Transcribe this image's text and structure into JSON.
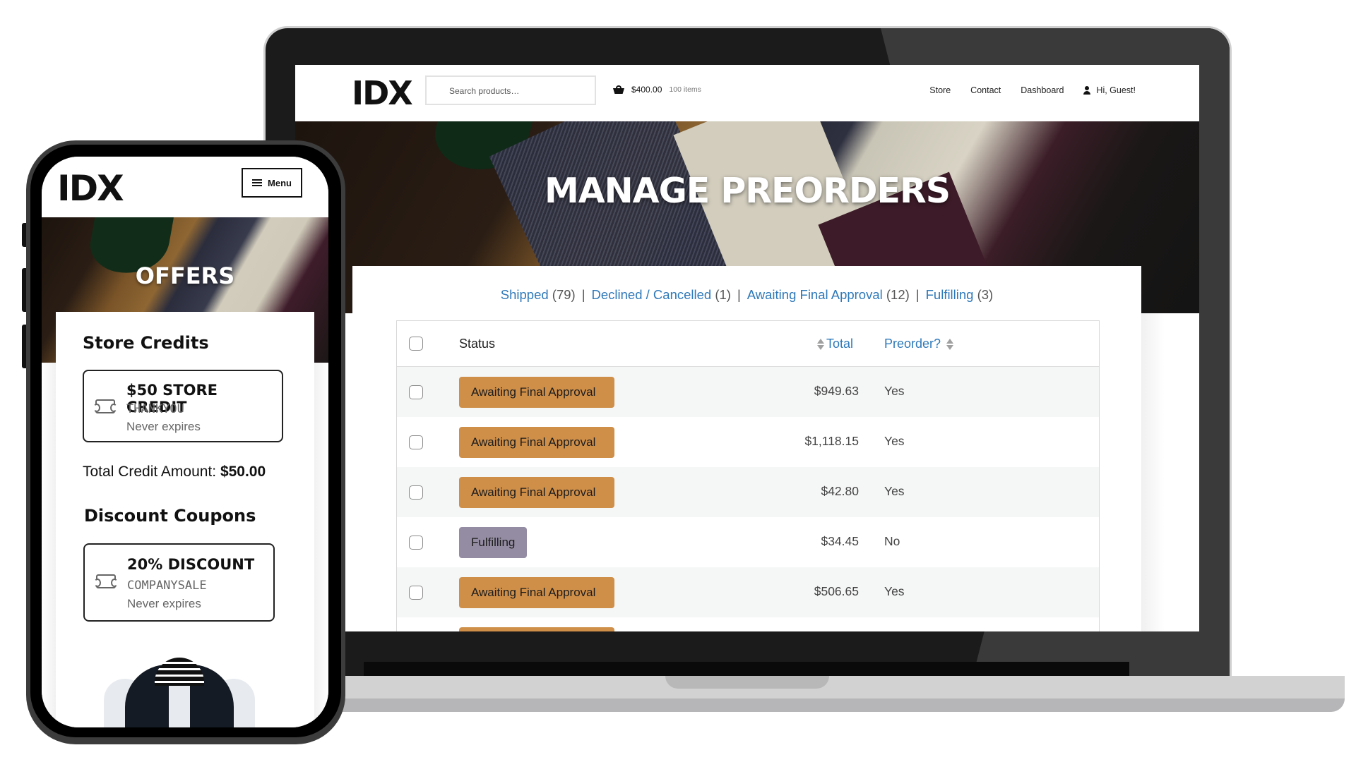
{
  "desktop": {
    "header": {
      "logo": "IDX",
      "search_placeholder": "Search products…",
      "cart_amount": "$400.00",
      "cart_items": "100 items",
      "nav": [
        "Store",
        "Contact",
        "Dashboard"
      ],
      "user_greeting": "Hi, Guest!"
    },
    "hero_title": "MANAGE PREORDERS",
    "filters": [
      {
        "label": "Shipped",
        "count": "(79)"
      },
      {
        "label": "Declined / Cancelled",
        "count": "(1)"
      },
      {
        "label": "Awaiting Final Approval",
        "count": "(12)"
      },
      {
        "label": "Fulfilling",
        "count": "(3)"
      }
    ],
    "table": {
      "columns": {
        "status": "Status",
        "total": "Total",
        "preorder": "Preorder?"
      },
      "rows": [
        {
          "status": "Awaiting Final Approval",
          "total": "$949.63",
          "preorder": "Yes"
        },
        {
          "status": "Awaiting Final Approval",
          "total": "$1,118.15",
          "preorder": "Yes"
        },
        {
          "status": "Awaiting Final Approval",
          "total": "$42.80",
          "preorder": "Yes"
        },
        {
          "status": "Fulfilling",
          "total": "$34.45",
          "preorder": "No"
        },
        {
          "status": "Awaiting Final Approval",
          "total": "$506.65",
          "preorder": "Yes"
        },
        {
          "status": "",
          "total": "",
          "preorder": ""
        }
      ]
    },
    "colors": {
      "link": "#2f79b9",
      "awaiting_badge": "#cf8f49",
      "fulfilling_badge": "#948ca2"
    }
  },
  "mobile": {
    "logo": "IDX",
    "menu_label": "Menu",
    "hero_title": "OFFERS",
    "store_credits_heading": "Store Credits",
    "store_credit": {
      "title": "$50 STORE CREDIT",
      "code": "THANKYOU",
      "expiry": "Never expires"
    },
    "total_credit_label": "Total Credit Amount:",
    "total_credit_value": "$50.00",
    "discount_heading": "Discount Coupons",
    "discount_coupon": {
      "title": "20% DISCOUNT",
      "code": "COMPANYSALE",
      "expiry": "Never expires"
    }
  }
}
